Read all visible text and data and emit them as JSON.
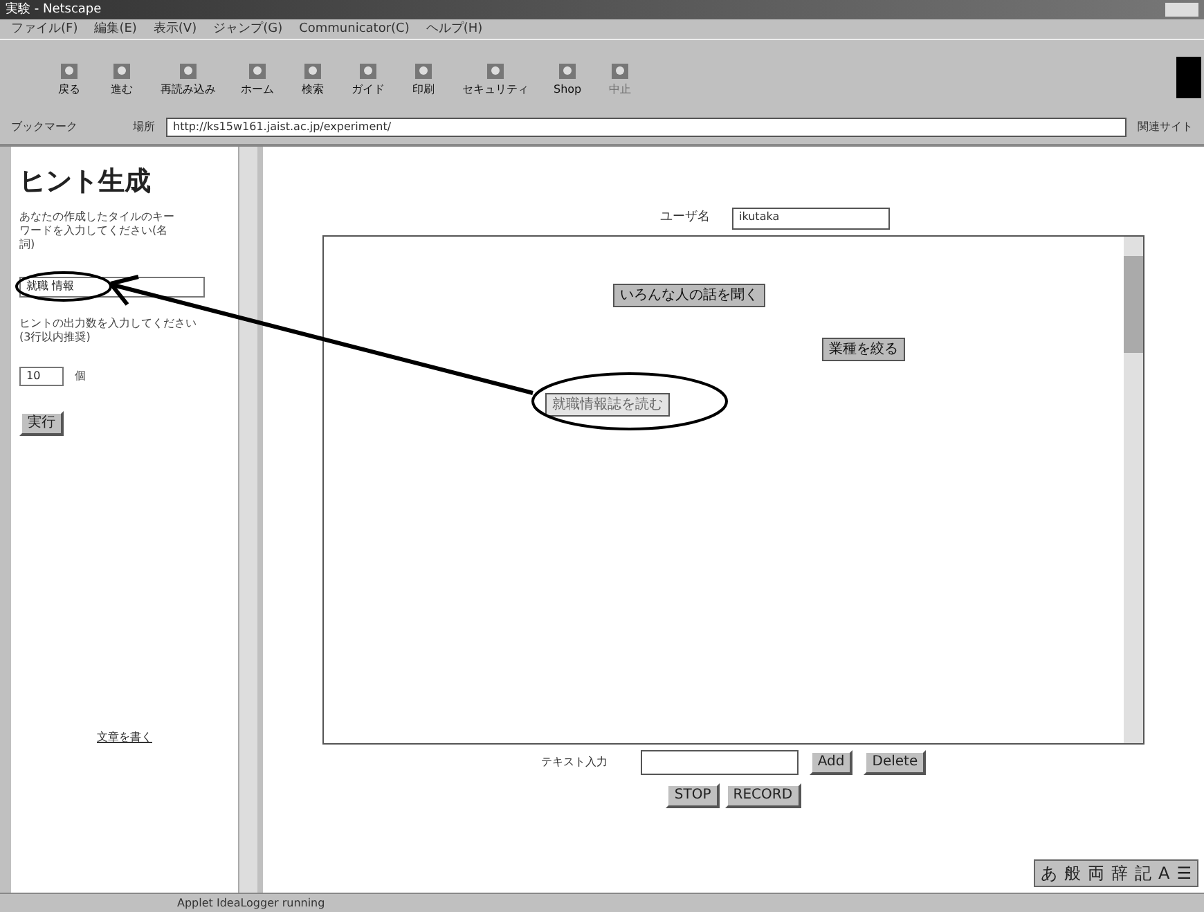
{
  "window": {
    "title": "実験 - Netscape"
  },
  "menu": [
    "ファイル(F)",
    "編集(E)",
    "表示(V)",
    "ジャンプ(G)",
    "Communicator(C)",
    "ヘルプ(H)"
  ],
  "toolbar": [
    {
      "label": "戻る",
      "disabled": false
    },
    {
      "label": "進む",
      "disabled": false
    },
    {
      "label": "再読み込み",
      "disabled": false
    },
    {
      "label": "ホーム",
      "disabled": false
    },
    {
      "label": "検索",
      "disabled": false
    },
    {
      "label": "ガイド",
      "disabled": false
    },
    {
      "label": "印刷",
      "disabled": false
    },
    {
      "label": "セキュリティ",
      "disabled": false
    },
    {
      "label": "Shop",
      "disabled": false
    },
    {
      "label": "中止",
      "disabled": true
    }
  ],
  "location_bar": {
    "bookmarks": "ブックマーク",
    "location_label": "場所",
    "url": "http://ks15w161.jaist.ac.jp/experiment/",
    "related": "関連サイト"
  },
  "left_frame": {
    "heading": "ヒント生成",
    "keyword_prompt": "あなたの作成したタイルのキーワードを入力してください(名詞)",
    "keyword_value": "就職 情報",
    "count_prompt": "ヒントの出力数を入力してください(3行以内推奨)",
    "count_value": "10",
    "count_unit": "個",
    "run_button": "実行",
    "write_link": "文章を書く"
  },
  "right_frame": {
    "user_label": "ユーザ名",
    "user_value": "ikutaka",
    "tiles": [
      {
        "text": "いろんな人の話を聞く",
        "selected": false
      },
      {
        "text": "業種を絞る",
        "selected": false
      },
      {
        "text": "就職情報誌を読む",
        "selected": true
      }
    ],
    "text_input_label": "テキスト入力",
    "buttons": [
      "Add",
      "Delete"
    ],
    "record_buttons": [
      "STOP",
      "RECORD"
    ]
  },
  "ime_bar": [
    "あ",
    "般",
    "両",
    "辞",
    "記",
    "A",
    "☰"
  ],
  "status_bar": {
    "text": "Applet IdeaLogger running"
  }
}
